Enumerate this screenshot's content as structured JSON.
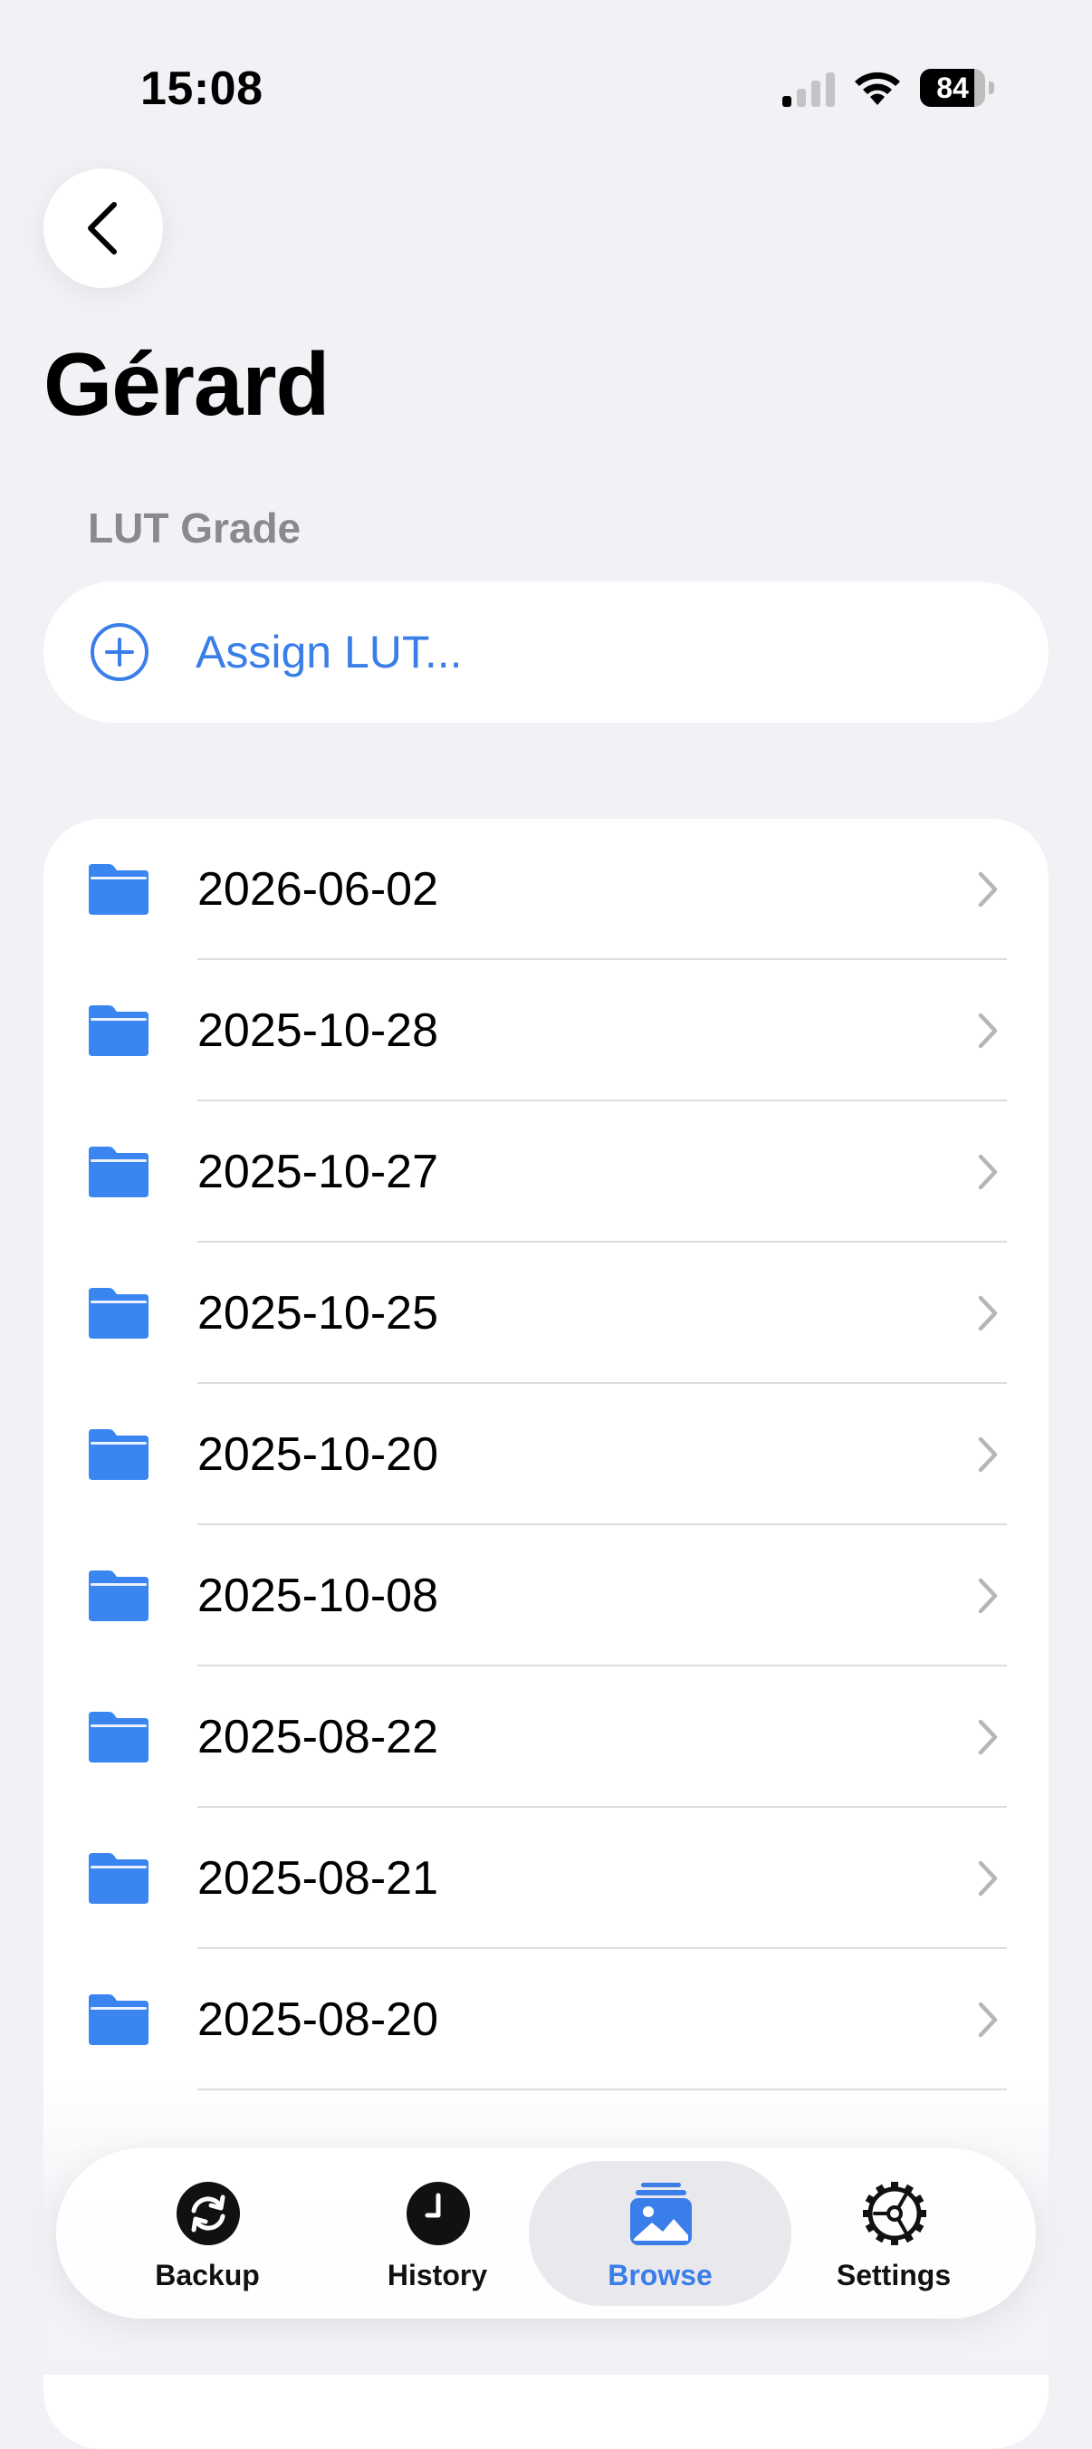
{
  "status_bar": {
    "time": "15:08",
    "battery_level": 84,
    "battery_label": "84",
    "signal_bars": 1,
    "icons": [
      "cellular-signal-icon",
      "wifi-icon",
      "battery-icon"
    ]
  },
  "header": {
    "back_icon": "chevron-left-icon",
    "title": "Gérard"
  },
  "lut_section": {
    "label": "LUT Grade",
    "assign_label": "Assign LUT...",
    "assign_icon": "plus-circle-icon"
  },
  "folders": [
    {
      "label": "2026-06-02"
    },
    {
      "label": "2025-10-28"
    },
    {
      "label": "2025-10-27"
    },
    {
      "label": "2025-10-25"
    },
    {
      "label": "2025-10-20"
    },
    {
      "label": "2025-10-08"
    },
    {
      "label": "2025-08-22"
    },
    {
      "label": "2025-08-21"
    },
    {
      "label": "2025-08-20"
    }
  ],
  "tab_bar": {
    "tabs": [
      {
        "label": "Backup",
        "icon": "sync-icon",
        "active": false
      },
      {
        "label": "History",
        "icon": "clock-icon",
        "active": false
      },
      {
        "label": "Browse",
        "icon": "photo-stack-icon",
        "active": true
      },
      {
        "label": "Settings",
        "icon": "gear-icon",
        "active": false
      }
    ]
  },
  "colors": {
    "accent": "#3a7ee9",
    "folder": "#3a85f0",
    "background": "#f2f1f6",
    "secondary_text": "#8a8a8e"
  }
}
